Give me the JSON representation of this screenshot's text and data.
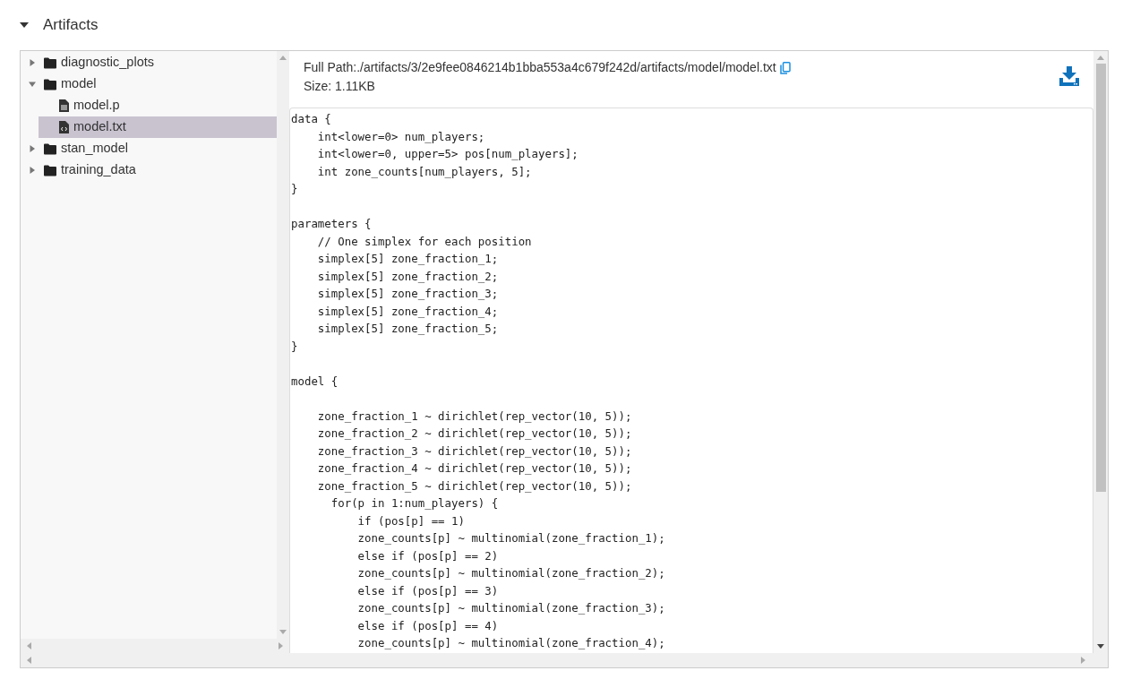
{
  "section": {
    "title": "Artifacts",
    "expanded": true
  },
  "tree": [
    {
      "label": "diagnostic_plots",
      "kind": "folder",
      "expanded": false,
      "selected": false
    },
    {
      "label": "model",
      "kind": "folder",
      "expanded": true,
      "selected": false,
      "children": [
        {
          "label": "model.p",
          "kind": "file",
          "selected": false
        },
        {
          "label": "model.txt",
          "kind": "code",
          "selected": true
        }
      ]
    },
    {
      "label": "stan_model",
      "kind": "folder",
      "expanded": false,
      "selected": false
    },
    {
      "label": "training_data",
      "kind": "folder",
      "expanded": false,
      "selected": false
    }
  ],
  "file_info": {
    "full_path": "Full Path:./artifacts/3/2e9fee0846214b1bba553a4c679f242d/artifacts/model/model.txt",
    "size": "Size: 1.11KB"
  },
  "code": "data {\n    int<lower=0> num_players;\n    int<lower=0, upper=5> pos[num_players];\n    int zone_counts[num_players, 5];\n}\n\nparameters {\n    // One simplex for each position\n    simplex[5] zone_fraction_1;\n    simplex[5] zone_fraction_2;\n    simplex[5] zone_fraction_3;\n    simplex[5] zone_fraction_4;\n    simplex[5] zone_fraction_5;\n}\n\nmodel {\n\n    zone_fraction_1 ~ dirichlet(rep_vector(10, 5));\n    zone_fraction_2 ~ dirichlet(rep_vector(10, 5));\n    zone_fraction_3 ~ dirichlet(rep_vector(10, 5));\n    zone_fraction_4 ~ dirichlet(rep_vector(10, 5));\n    zone_fraction_5 ~ dirichlet(rep_vector(10, 5));\n      for(p in 1:num_players) {\n          if (pos[p] == 1)\n          zone_counts[p] ~ multinomial(zone_fraction_1);\n          else if (pos[p] == 2)\n          zone_counts[p] ~ multinomial(zone_fraction_2);\n          else if (pos[p] == 3)\n          zone_counts[p] ~ multinomial(zone_fraction_3);\n          else if (pos[p] == 4)\n          zone_counts[p] ~ multinomial(zone_fraction_4);"
}
